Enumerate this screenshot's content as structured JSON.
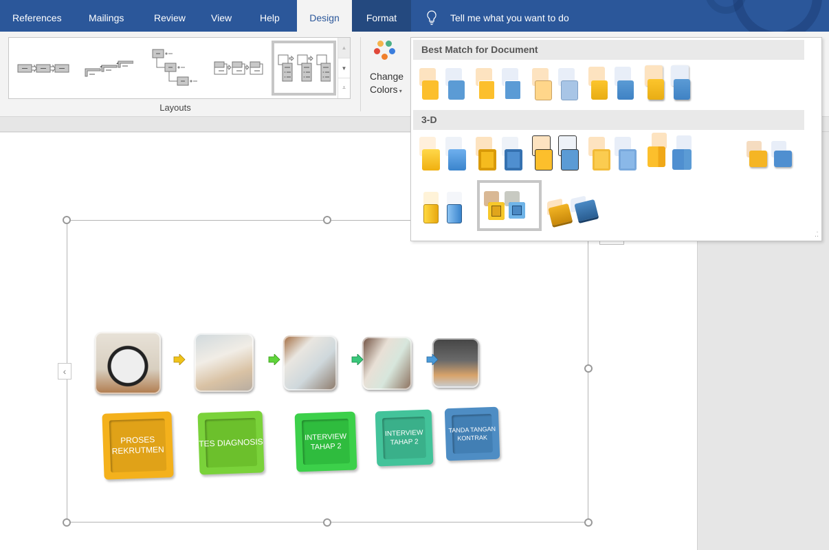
{
  "tabs": [
    {
      "label": "References",
      "active": false
    },
    {
      "label": "Mailings",
      "active": false
    },
    {
      "label": "Review",
      "active": false
    },
    {
      "label": "View",
      "active": false
    },
    {
      "label": "Help",
      "active": false
    },
    {
      "label": "Design",
      "active": true
    },
    {
      "label": "Format",
      "active": false
    }
  ],
  "tell_me": {
    "placeholder": "Tell me what you want to do",
    "icon": "lightbulb-icon"
  },
  "ribbon": {
    "layouts_group_label": "Layouts",
    "layouts": [
      {
        "name": "basic-process"
      },
      {
        "name": "step-up-process"
      },
      {
        "name": "staggered-process"
      },
      {
        "name": "accent-process"
      },
      {
        "name": "picture-accent-process",
        "selected": true
      }
    ],
    "change_colors": {
      "label_line1": "Change",
      "label_line2": "Colors",
      "dot_colors": [
        "#f5b34a",
        "#4caf86",
        "#e0483a",
        "#3b7ddd",
        "#f0802d"
      ]
    }
  },
  "smartart_styles_dropdown": {
    "sections": [
      {
        "title": "Best Match for Document",
        "items": [
          {
            "name": "simple-fill",
            "front": "#fcbf2c",
            "back": "#5b9bd5"
          },
          {
            "name": "white-outline",
            "front": "#fcbf2c",
            "back": "#5b9bd5"
          },
          {
            "name": "subtle-effect",
            "front": "#ffd68a",
            "back": "#a8c5e6"
          },
          {
            "name": "moderate-effect",
            "front": "#f9bc20",
            "back": "#4f8fd0"
          },
          {
            "name": "intense-effect",
            "front": "#fcbf2c",
            "back": "#4f8fd0"
          }
        ]
      },
      {
        "title": "3-D",
        "items": [
          {
            "name": "polished",
            "front": "#fcc52c",
            "back": "#4f95d8"
          },
          {
            "name": "inset",
            "front": "#f5bb1e",
            "back": "#4f8fd0"
          },
          {
            "name": "cartoon",
            "front": "#fcbf2c",
            "back": "#5b9bd5"
          },
          {
            "name": "powder",
            "front": "#fbcc50",
            "back": "#8ab8e8"
          },
          {
            "name": "brick-scene",
            "front": "#fcbf2c",
            "back": "#5b9bd5"
          },
          {
            "name": "flat-scene",
            "front": "#f5b524",
            "back": "#4f8fd0"
          },
          {
            "name": "metallic-scene",
            "front": "#fcc52c",
            "back": "#6aa8e6"
          },
          {
            "name": "sunset-scene",
            "front": "#e0a51c",
            "back": "#4a89c4",
            "selected": true
          },
          {
            "name": "bird-eye-scene",
            "front": "#e9a514",
            "back": "#3a77b8"
          }
        ]
      }
    ]
  },
  "diagram": {
    "steps": [
      {
        "photo": "alarm-clock-photo",
        "label": "PROSES REKRUTMEN",
        "color": "#f4b11c",
        "arrow_color": "#f0c31a"
      },
      {
        "photo": "call-center-photo",
        "label": "TES DIAGNOSIS",
        "color": "#7ad23a",
        "arrow_color": "#5fd43a"
      },
      {
        "photo": "documents-photo",
        "label": "INTERVIEW TAHAP 2",
        "color": "#3cd04a",
        "arrow_color": "#39c77a"
      },
      {
        "photo": "handshake-documents-photo",
        "label": "INTERVIEW TAHAP 2",
        "color": "#43c39a",
        "arrow_color": "#4a9ad8"
      },
      {
        "photo": "handshake-photo",
        "label": "TANDA TANGAN KONTRAK",
        "color": "#4e8dc4",
        "arrow_color": null
      }
    ]
  }
}
